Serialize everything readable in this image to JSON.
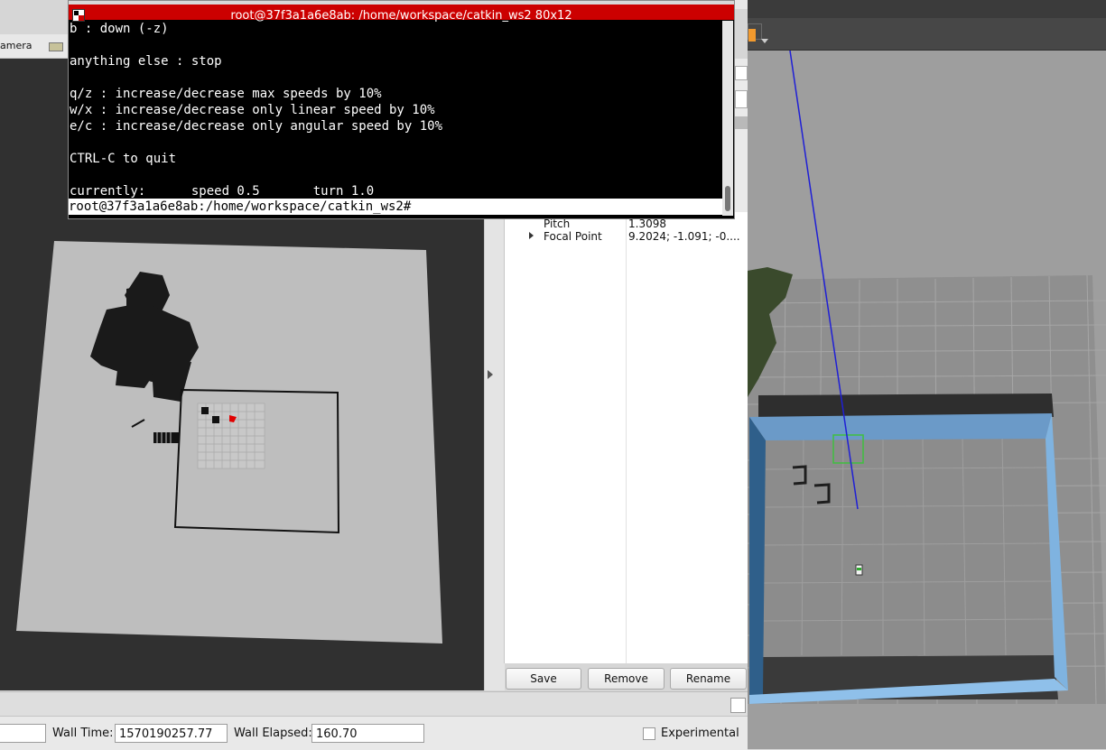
{
  "terminal": {
    "title": "root@37f3a1a6e8ab: /home/workspace/catkin_ws2 80x12",
    "lines": [
      "b : down (-z)",
      "",
      "anything else : stop",
      "",
      "q/z : increase/decrease max speeds by 10%",
      "w/x : increase/decrease only linear speed by 10%",
      "e/c : increase/decrease only angular speed by 10%",
      "",
      "CTRL-C to quit",
      "",
      "currently:      speed 0.5       turn 1.0"
    ],
    "prompt": "root@37f3a1a6e8ab:/home/workspace/catkin_ws2#"
  },
  "rviz": {
    "toolbar_label": "amera",
    "views": {
      "properties": [
        {
          "name": "Pitch",
          "value": "1.3098"
        },
        {
          "name": "Focal Point",
          "value": "9.2024; -1.091; -0...."
        }
      ],
      "buttons": {
        "save": "Save",
        "remove": "Remove",
        "rename": "Rename"
      }
    },
    "timebar": {
      "wall_time_label": "Wall Time:",
      "wall_time_value": "1570190257.77",
      "wall_elapsed_label": "Wall Elapsed:",
      "wall_elapsed_value": "160.70",
      "experimental_label": "Experimental"
    }
  },
  "colors": {
    "terminal_title_bar": "#cc0000",
    "map_free_space": "#bebebe",
    "map_unknown": "#303030",
    "gazebo_wall": "#7fb3e0"
  }
}
